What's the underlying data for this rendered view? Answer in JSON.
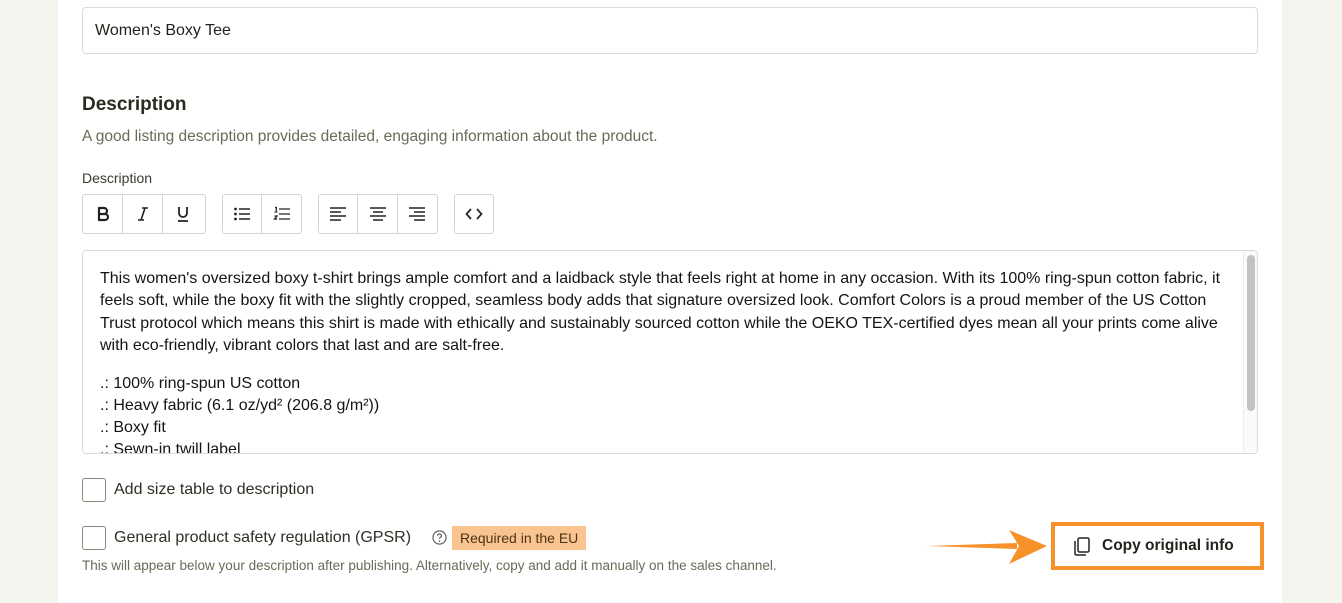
{
  "product": {
    "title_value": "Women's Boxy Tee"
  },
  "description_section": {
    "heading": "Description",
    "subtext": "A good listing description provides detailed, engaging information about the product.",
    "field_label": "Description"
  },
  "toolbar": {
    "groups": [
      [
        "bold-icon",
        "italic-icon",
        "underline-icon"
      ],
      [
        "bullet-list-icon",
        "numbered-list-icon"
      ],
      [
        "align-left-icon",
        "align-center-icon",
        "align-right-icon"
      ],
      [
        "code-icon"
      ]
    ]
  },
  "editor": {
    "paragraph": "This women's oversized boxy t-shirt brings ample comfort and a laidback style that feels right at home in any occasion. With its 100% ring-spun cotton fabric, it feels soft, while the boxy fit with the slightly cropped, seamless body adds that signature oversized look. Comfort Colors is a proud member of the US Cotton Trust protocol which means this shirt is made with ethically and sustainably sourced cotton while the OEKO TEX-certified dyes mean all your prints come alive with eco-friendly, vibrant colors that last and are salt-free.",
    "bullets": [
      ".: 100% ring-spun US cotton",
      ".: Heavy fabric (6.1 oz/yd² (206.8 g/m²))",
      ".: Boxy fit",
      ".: Sewn-in twill label"
    ]
  },
  "options": {
    "size_table_label": "Add size table to description",
    "gpsr_label": "General product safety regulation (GPSR)",
    "gpsr_badge": "Required in the EU",
    "gpsr_note": "This will appear below your description after publishing. Alternatively, copy and add it manually on the sales channel."
  },
  "copy_button": {
    "label": "Copy original info",
    "icon": "copy-icon"
  },
  "colors": {
    "highlight": "#f7922a",
    "badge_bg": "#f9c48f",
    "page_bg": "#f5f4ee"
  }
}
